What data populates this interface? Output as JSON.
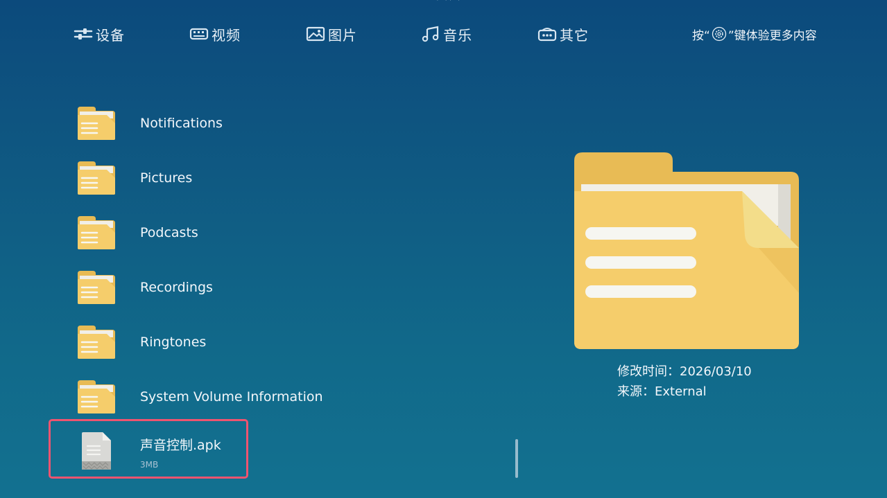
{
  "nav": {
    "items": [
      {
        "label": "设备",
        "icon": "sliders-icon"
      },
      {
        "label": "视频",
        "icon": "video-icon"
      },
      {
        "label": "图片",
        "icon": "image-icon"
      },
      {
        "label": "音乐",
        "icon": "music-note-icon"
      },
      {
        "label": "其它",
        "icon": "misc-box-icon"
      }
    ],
    "hint_prefix": "按“",
    "hint_suffix": "”键体验更多内容",
    "hint_icon": "settings-gear-icon"
  },
  "list": {
    "folders": [
      {
        "name": "Notifications"
      },
      {
        "name": "Pictures"
      },
      {
        "name": "Podcasts"
      },
      {
        "name": "Recordings"
      },
      {
        "name": "Ringtones"
      },
      {
        "name": "System Volume Information"
      }
    ],
    "selected_file": {
      "name": "声音控制.apk",
      "size": "3MB"
    }
  },
  "details": {
    "modified": "修改时间：2026/03/10",
    "source": "来源：External"
  },
  "colors": {
    "folder": "#f5cd6b",
    "folder_dark": "#e8bb55",
    "selection_border": "#ef5470"
  }
}
